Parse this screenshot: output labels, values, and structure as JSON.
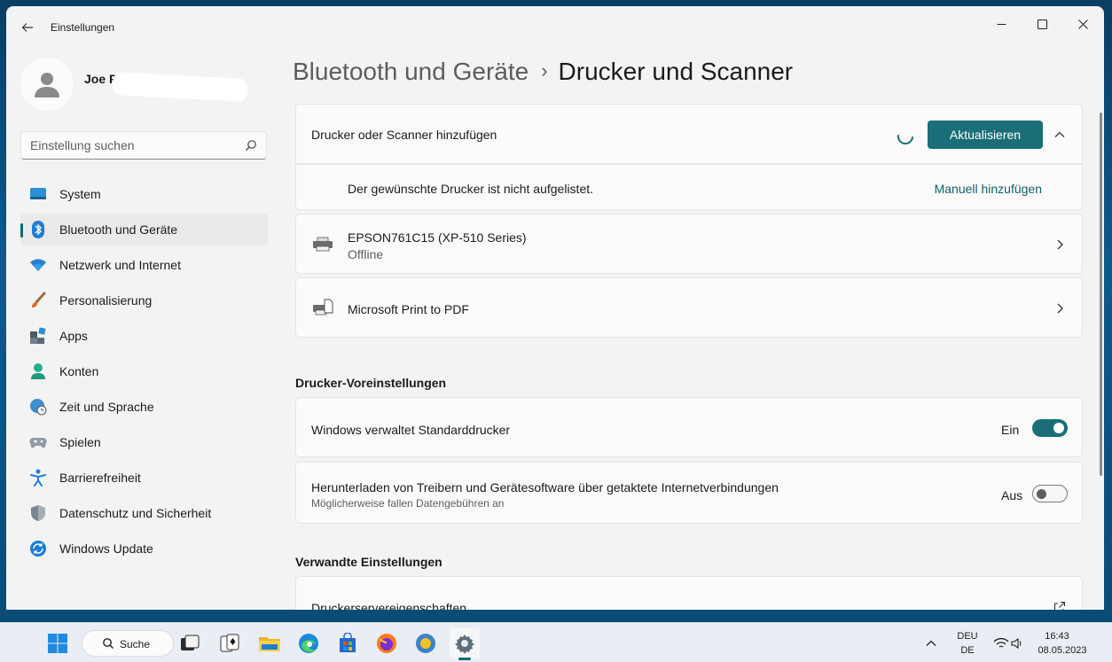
{
  "window": {
    "title": "Einstellungen",
    "controls": [
      "minimize",
      "maximize",
      "close"
    ]
  },
  "profile": {
    "name": "Joe P"
  },
  "search": {
    "placeholder": "Einstellung suchen"
  },
  "sidebar": {
    "items": [
      {
        "label": "System",
        "icon": "monitor-icon",
        "active": false
      },
      {
        "label": "Bluetooth und Geräte",
        "icon": "bluetooth-icon",
        "active": true
      },
      {
        "label": "Netzwerk und Internet",
        "icon": "wifi-icon",
        "active": false
      },
      {
        "label": "Personalisierung",
        "icon": "brush-icon",
        "active": false
      },
      {
        "label": "Apps",
        "icon": "apps-icon",
        "active": false
      },
      {
        "label": "Konten",
        "icon": "account-icon",
        "active": false
      },
      {
        "label": "Zeit und Sprache",
        "icon": "globe-clock-icon",
        "active": false
      },
      {
        "label": "Spielen",
        "icon": "gamepad-icon",
        "active": false
      },
      {
        "label": "Barrierefreiheit",
        "icon": "accessibility-icon",
        "active": false
      },
      {
        "label": "Datenschutz und Sicherheit",
        "icon": "shield-icon",
        "active": false
      },
      {
        "label": "Windows Update",
        "icon": "update-icon",
        "active": false
      }
    ]
  },
  "breadcrumb": {
    "parent": "Bluetooth und Geräte",
    "separator": "›",
    "current": "Drucker und Scanner"
  },
  "add_printer": {
    "label": "Drucker oder Scanner hinzufügen",
    "refresh_button": "Aktualisieren",
    "not_listed": "Der gewünschte Drucker ist nicht aufgelistet.",
    "manual_link": "Manuell hinzufügen"
  },
  "printers": [
    {
      "name": "EPSON761C15 (XP-510 Series)",
      "status": "Offline"
    },
    {
      "name": "Microsoft Print to PDF",
      "status": ""
    }
  ],
  "preferences": {
    "title": "Drucker-Voreinstellungen",
    "default_printer": {
      "label": "Windows verwaltet Standarddrucker",
      "state": "Ein",
      "on": true
    },
    "metered_download": {
      "label": "Herunterladen von Treibern und Gerätesoftware über getaktete Internetverbindungen",
      "sub": "Möglicherweise fallen Datengebühren an",
      "state": "Aus",
      "on": false
    }
  },
  "related": {
    "title": "Verwandte Einstellungen",
    "server_props": "Druckerservereigenschaften"
  },
  "taskbar": {
    "search_label": "Suche",
    "lang_top": "DEU",
    "lang_bottom": "DE",
    "time": "16:43",
    "date": "08.05.2023"
  },
  "colors": {
    "accent": "#1a6e78",
    "link": "#0f5f68"
  }
}
